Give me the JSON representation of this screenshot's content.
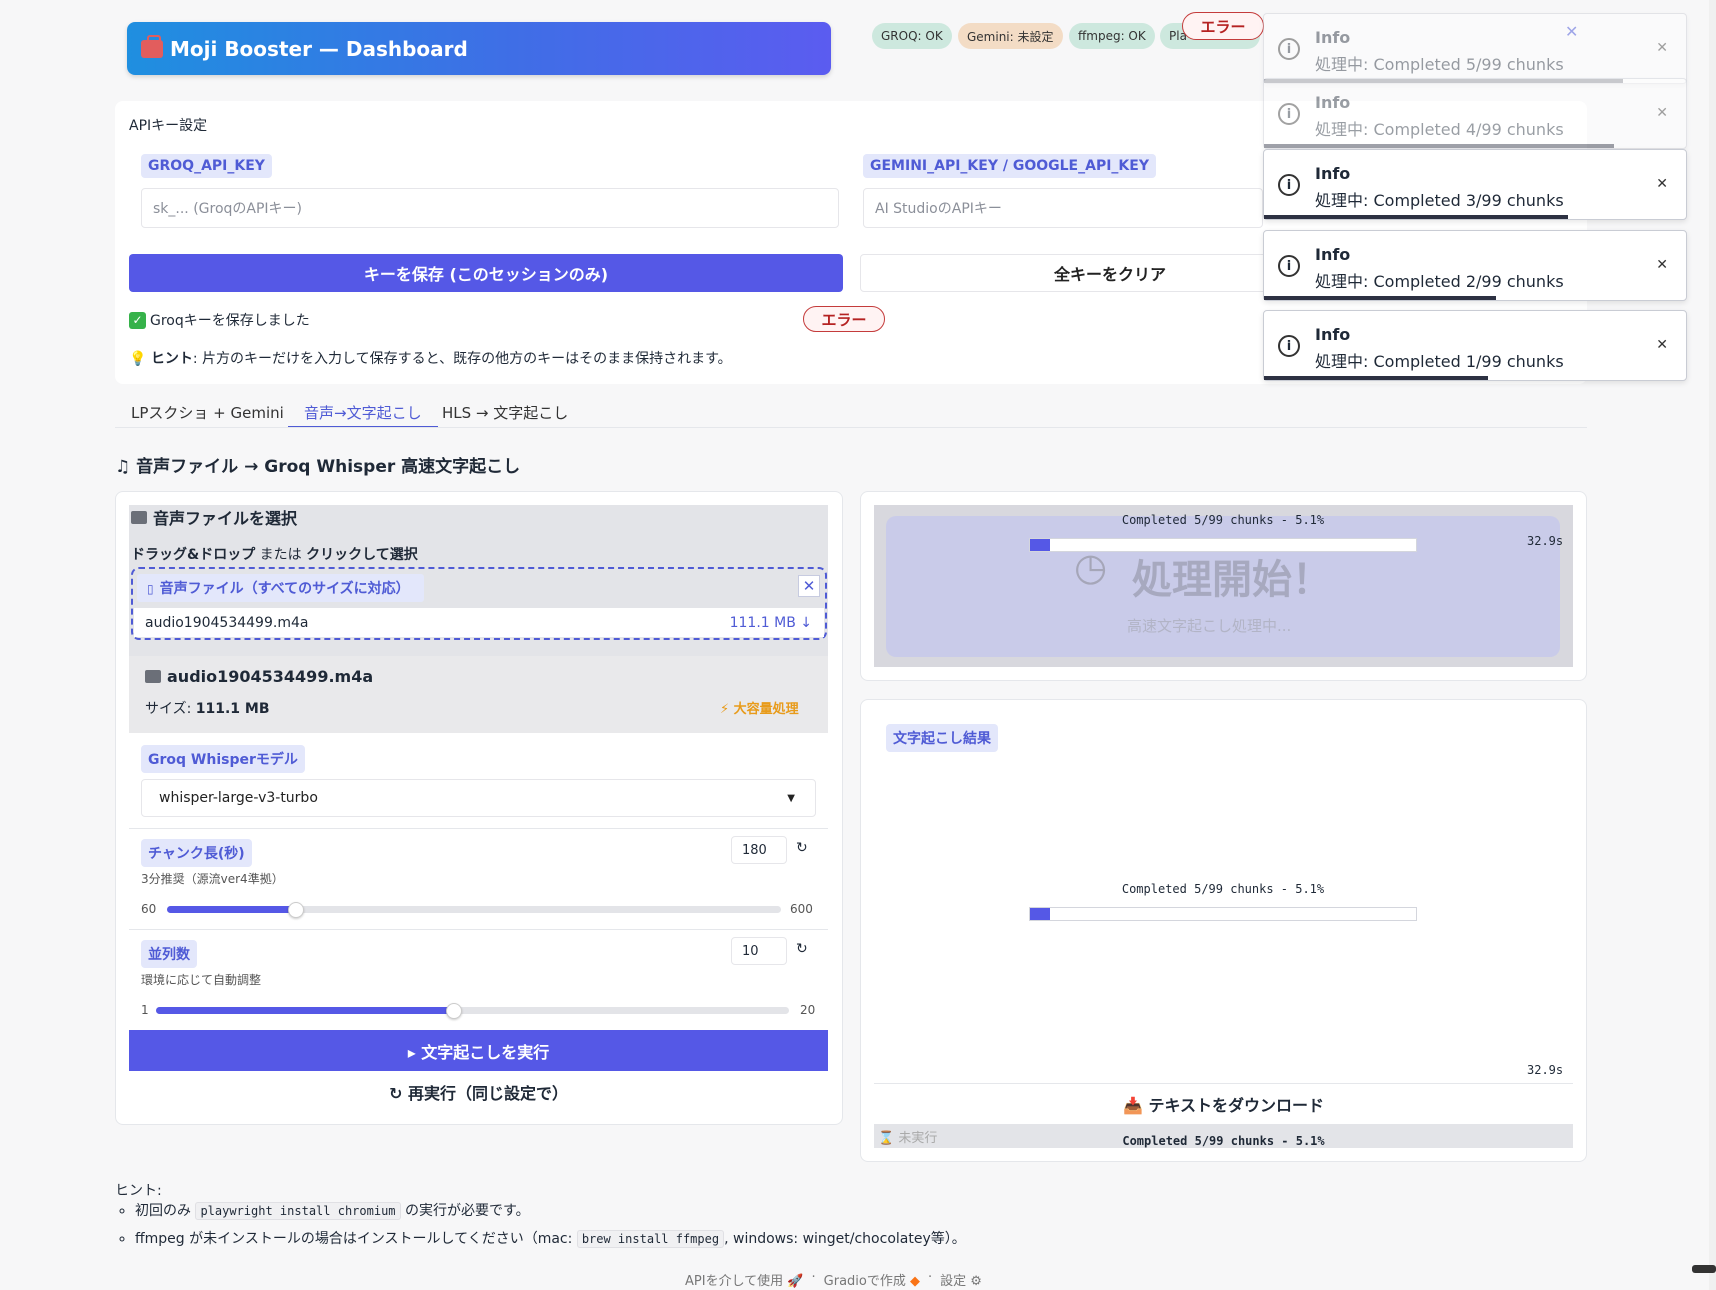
{
  "header": {
    "title": "Moji Booster — Dashboard",
    "icon": "toolbox-icon"
  },
  "status_badges": [
    "GROQ: OK",
    "Gemini: 未設定",
    "ffmpeg: OK",
    "Pla"
  ],
  "error_label": "エラー",
  "api": {
    "section_title": "APIキー設定",
    "groq_label": "GROQ_API_KEY",
    "groq_placeholder": "sk_... (GroqのAPIキー)",
    "gemini_label": "GEMINI_API_KEY / GOOGLE_API_KEY",
    "gemini_placeholder": "AI StudioのAPIキー",
    "save_button": "キーを保存 (このセッションのみ)",
    "clear_button": "全キーをクリア",
    "saved_message": "Groqキーを保存しました",
    "hint_bold": "ヒント",
    "hint_text": ": 片方のキーだけを入力して保存すると、既存の他方のキーはそのまま保持されます。"
  },
  "tabs": [
    "LPスクショ + Gemini",
    "音声→文字起こし",
    "HLS → 文字起こし"
  ],
  "active_tab": 1,
  "section_heading": "音声ファイル → Groq Whisper 高速文字起こし",
  "upload": {
    "title": "音声ファイルを選択",
    "dnd_bold1": "ドラッグ&ドロップ",
    "dnd_mid": " または ",
    "dnd_bold2": "クリックして選択",
    "file_label": "音声ファイル（すべてのサイズに対応）",
    "file_name": "audio1904534499.m4a",
    "file_size": "111.1 MB ↓"
  },
  "file_info": {
    "name": "audio1904534499.m4a",
    "size_label": "サイズ: ",
    "size_value": "111.1 MB",
    "large_label": "⚡ 大容量処理"
  },
  "model": {
    "label": "Groq Whisperモデル",
    "value": "whisper-large-v3-turbo"
  },
  "chunk": {
    "label": "チャンク長(秒)",
    "desc": "3分推奨（源流ver4準拠）",
    "value": "180",
    "min": "60",
    "max": "600",
    "fraction": 0.21
  },
  "parallel": {
    "label": "並列数",
    "desc": "環境に応じて自動調整",
    "value": "10",
    "min": "1",
    "max": "20",
    "fraction": 0.47
  },
  "run_button": "▸ 文字起こしを実行",
  "rerun_button": "再実行（同じ設定で）",
  "progress": {
    "text": "Completed 5/99 chunks - 5.1%",
    "fraction": 0.051,
    "time": "32.9s",
    "ghost_title": "処理開始！",
    "ghost_sub": "高速文字起こし処理中..."
  },
  "result": {
    "label": "文字起こし結果",
    "download": "テキストをダウンロード",
    "status": "未実行"
  },
  "toasts": [
    {
      "title": "Info",
      "message": "処理中: Completed 5/99 chunks",
      "progress": 0.85,
      "faded": true
    },
    {
      "title": "Info",
      "message": "処理中: Completed 4/99 chunks",
      "progress": 0.83,
      "faded": true
    },
    {
      "title": "Info",
      "message": "処理中: Completed 3/99 chunks",
      "progress": 0.72,
      "faded": false
    },
    {
      "title": "Info",
      "message": "処理中: Completed 2/99 chunks",
      "progress": 0.55,
      "faded": false
    },
    {
      "title": "Info",
      "message": "処理中: Completed 1/99 chunks",
      "progress": 0.53,
      "faded": false
    }
  ],
  "hints": {
    "title": "ヒント:",
    "item1_pre": "初回のみ ",
    "item1_code": "playwright install chromium",
    "item1_post": " の実行が必要です。",
    "item2_pre": "ffmpeg が未インストールの場合はインストールしてください（mac: ",
    "item2_code": "brew install ffmpeg",
    "item2_post": ", windows: winget/chocolatey等）。"
  },
  "footer": {
    "api": "APIを介して使用",
    "gradio": "Gradioで作成",
    "settings": "設定"
  }
}
